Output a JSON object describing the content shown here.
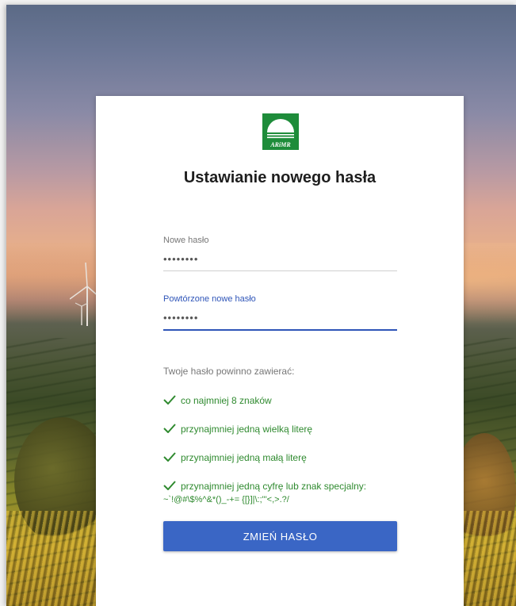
{
  "logo": {
    "text": "ARiMR",
    "icon": "arimr-logo"
  },
  "title": "Ustawianie nowego hasła",
  "fields": [
    {
      "label": "Nowe hasło",
      "value": "••••••••"
    },
    {
      "label": "Powtórzone nowe hasło",
      "value": "••••••••"
    }
  ],
  "requirements": {
    "intro": "Twoje hasło powinno zawierać:",
    "items": [
      "co najmniej 8 znaków",
      "przynajmniej jedną wielką literę",
      "przynajmniej jedną małą literę",
      "przynajmniej jedną cyfrę lub znak specjalny:"
    ],
    "special_chars": "~`!@#\\$%^&*()_-+= {[}]|\\:;\"'<,>.?/"
  },
  "submit_label": "ZMIEŃ HASŁO",
  "colors": {
    "accent": "#3a66c5",
    "check_green": "#2f8a2f",
    "logo_green": "#1e8c3a"
  }
}
